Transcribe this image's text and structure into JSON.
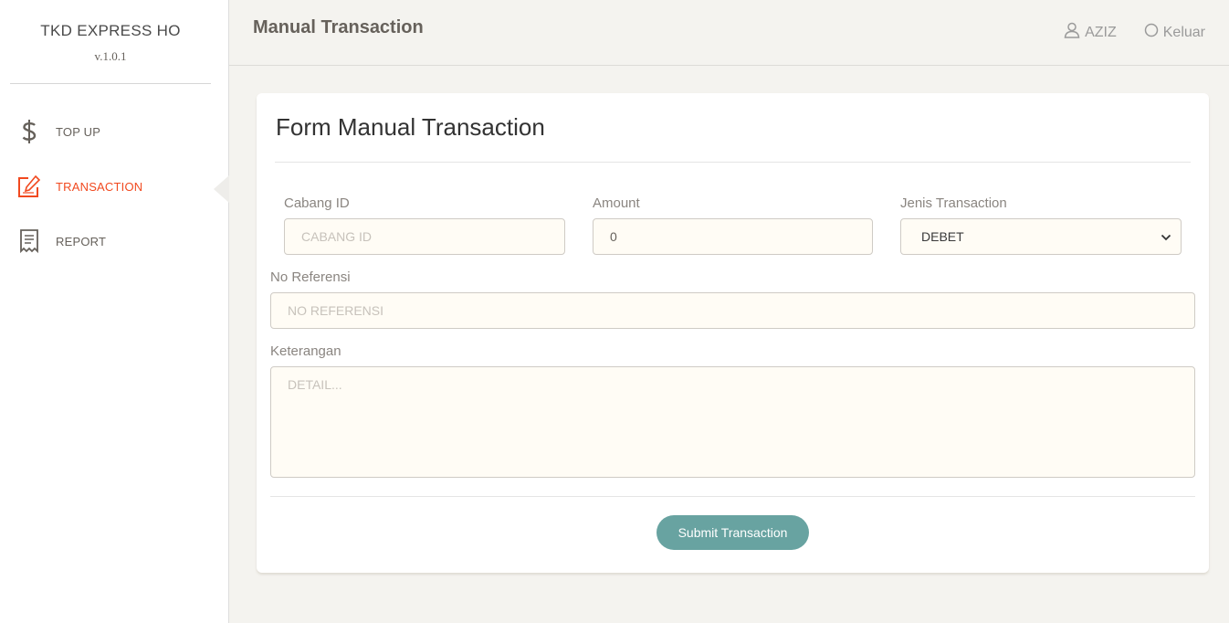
{
  "sidebar": {
    "brand_title": "TKD EXPRESS HO",
    "brand_version": "v.1.0.1",
    "items": [
      {
        "label": "TOP UP",
        "icon": "dollar-icon"
      },
      {
        "label": "TRANSACTION",
        "icon": "edit-icon",
        "active": true
      },
      {
        "label": "REPORT",
        "icon": "receipt-icon"
      }
    ]
  },
  "header": {
    "title": "Manual Transaction",
    "user_label": "AZIZ",
    "logout_label": "Keluar"
  },
  "form": {
    "title": "Form Manual Transaction",
    "cabang_id": {
      "label": "Cabang ID",
      "placeholder": "CABANG ID",
      "value": ""
    },
    "amount": {
      "label": "Amount",
      "value": "0"
    },
    "jenis": {
      "label": "Jenis Transaction",
      "selected": "DEBET"
    },
    "no_referensi": {
      "label": "No Referensi",
      "placeholder": "NO REFERENSI",
      "value": ""
    },
    "keterangan": {
      "label": "Keterangan",
      "placeholder": "DETAIL..."
    },
    "submit_label": "Submit Transaction"
  },
  "colors": {
    "accent": "#f1491f",
    "button": "#68a3a1",
    "background": "#f4f3ef",
    "input_bg": "#fffcf5"
  }
}
